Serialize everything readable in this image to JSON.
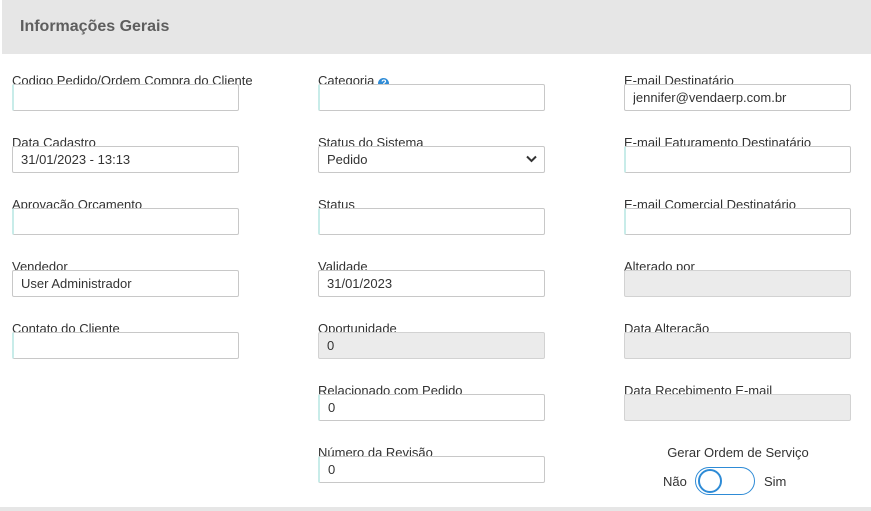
{
  "panel": {
    "title": "Informações Gerais"
  },
  "col1": {
    "codigo": {
      "label": "Codigo Pedido/Ordem Compra do Cliente",
      "value": ""
    },
    "data_cadastro": {
      "label": "Data Cadastro",
      "value": "31/01/2023 - 13:13"
    },
    "aprovacao": {
      "label": "Aprovação Orçamento",
      "value": ""
    },
    "vendedor": {
      "label": "Vendedor",
      "value": "User Administrador"
    },
    "contato": {
      "label": "Contato do Cliente",
      "value": ""
    }
  },
  "col2": {
    "categoria": {
      "label": "Categoria",
      "help_icon": "question-circle-icon",
      "value": ""
    },
    "status_sistema": {
      "label": "Status do Sistema",
      "selected": "Pedido"
    },
    "status": {
      "label": "Status",
      "value": ""
    },
    "validade": {
      "label": "Validade",
      "value": "31/01/2023"
    },
    "oportunidade": {
      "label": "Oportunidade",
      "value": "0"
    },
    "relacionado": {
      "label": "Relacionado com Pedido",
      "value": "0"
    },
    "revisao": {
      "label": "Número da Revisão",
      "value": "0"
    }
  },
  "col3": {
    "email_dest": {
      "label": "E-mail Destinatário",
      "value": "jennifer@vendaerp.com.br"
    },
    "email_fat": {
      "label": "E-mail Faturamento Destinatário",
      "value": ""
    },
    "email_com": {
      "label": "E-mail Comercial Destinatário",
      "value": ""
    },
    "alterado_por": {
      "label": "Alterado por",
      "value": ""
    },
    "data_alteracao": {
      "label": "Data Alteração",
      "value": ""
    },
    "data_recebimento": {
      "label": "Data Recebimento E-mail",
      "value": ""
    },
    "gerar_os": {
      "label": "Gerar Ordem de Serviço",
      "off_label": "Não",
      "on_label": "Sim",
      "checked": false
    }
  },
  "colors": {
    "accent": "#2e8bd6",
    "header_bg": "#e6e6e6",
    "disabled_bg": "#ebebeb"
  }
}
